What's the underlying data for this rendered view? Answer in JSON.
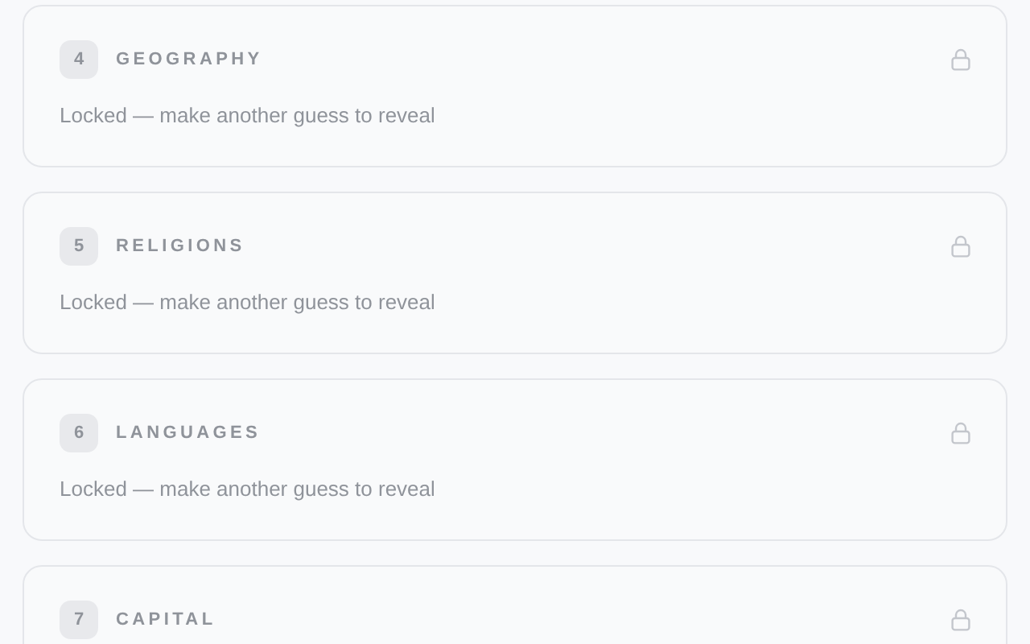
{
  "clues": [
    {
      "number": "4",
      "title": "GEOGRAPHY",
      "locked": true,
      "message": "Locked — make another guess to reveal"
    },
    {
      "number": "5",
      "title": "RELIGIONS",
      "locked": true,
      "message": "Locked — make another guess to reveal"
    },
    {
      "number": "6",
      "title": "LANGUAGES",
      "locked": true,
      "message": "Locked — make another guess to reveal"
    },
    {
      "number": "7",
      "title": "CAPITAL",
      "locked": true
    }
  ]
}
